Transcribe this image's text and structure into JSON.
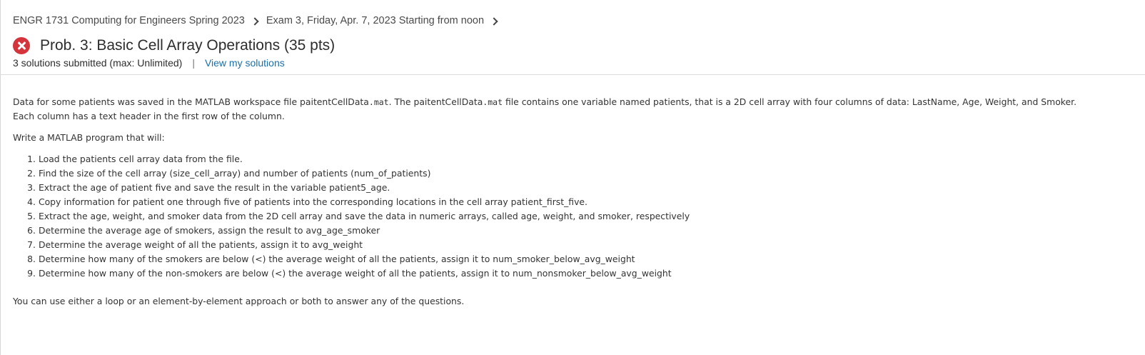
{
  "breadcrumb": {
    "course": "ENGR 1731 Computing for Engineers Spring 2023",
    "assessment": "Exam 3, Friday, Apr. 7, 2023 Starting from noon"
  },
  "problem": {
    "title": "Prob. 3: Basic Cell Array Operations (35 pts)",
    "status_color": "#d4343c",
    "submissions": "3 solutions submitted (max: Unlimited)",
    "separator": "|",
    "view_link": "View my solutions"
  },
  "description": {
    "p1_a": "Data for some patients was saved in the MATLAB workspace file paitentCellData",
    "p1_ext1": ".mat",
    "p1_b": ". The paitentCellData",
    "p1_ext2": ".mat",
    "p1_c": " file contains one variable named patients, that is a 2D cell array with four columns of data: LastName, Age, Weight, and Smoker. Each column has a text header in the first row of the column.",
    "p2": "Write a MATLAB program that will:",
    "steps": [
      {
        "num": "1.",
        "text": "Load the patients cell array data from the file."
      },
      {
        "num": "2.",
        "text": "Find the size of the cell array (size_cell_array) and number of patients (num_of_patients)"
      },
      {
        "num": "3.",
        "text": "Extract the age of patient five and save the result in the variable patient5_age."
      },
      {
        "num": "4.",
        "text": "Copy information for patient one through five of patients into the corresponding locations in the cell array patient_first_five."
      },
      {
        "num": "5.",
        "text": "Extract the age, weight, and smoker data from the 2D cell array and save the data in numeric arrays, called age, weight, and smoker, respectively"
      },
      {
        "num": "6.",
        "text": "Determine the average age of smokers, assign the result to avg_age_smoker"
      },
      {
        "num": "7.",
        "text": "Determine the average weight of all the patients, assign it to avg_weight"
      },
      {
        "num": "8.",
        "text": "Determine how many of the smokers are below (<) the average weight of all the patients, assign it to num_smoker_below_avg_weight"
      },
      {
        "num": "9.",
        "text": "Determine how many of the non-smokers are below (<) the average weight of all the patients, assign it to num_nonsmoker_below_avg_weight"
      }
    ],
    "p3": "You can use either a loop or an element-by-element approach or both to answer any of the questions."
  }
}
